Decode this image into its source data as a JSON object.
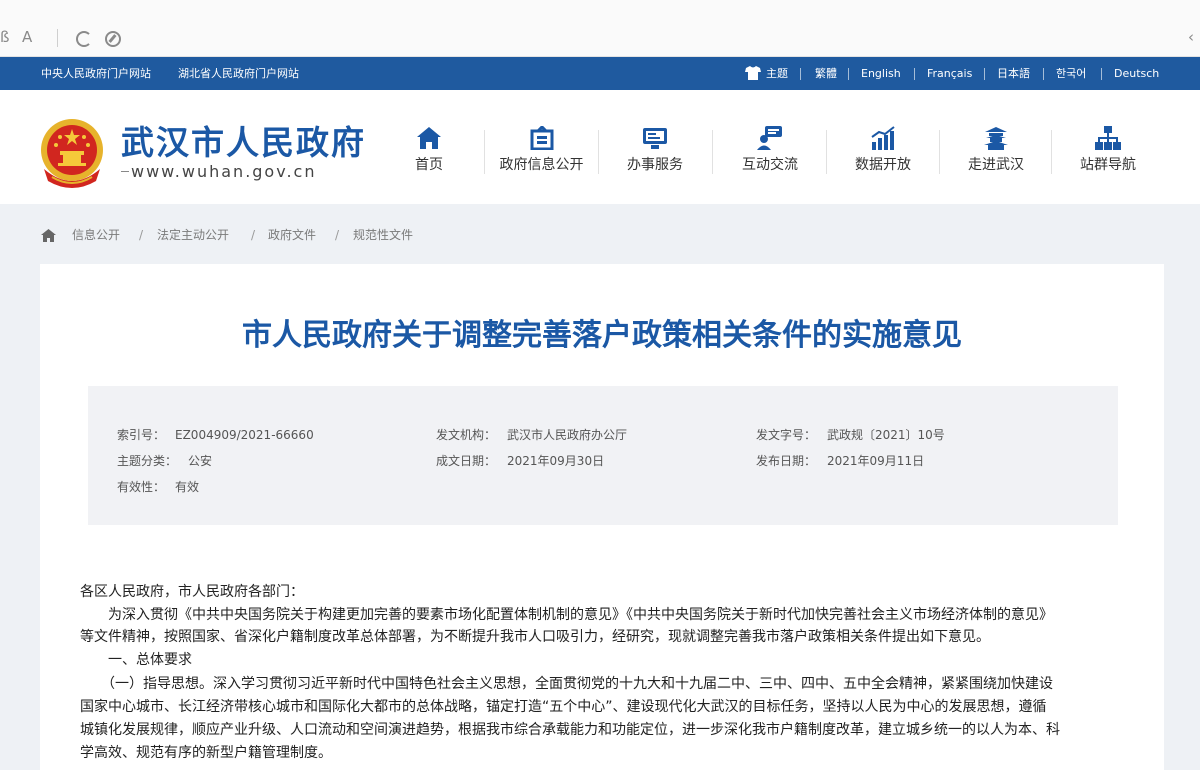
{
  "browser": {
    "glyph_left": "ß",
    "glyph_a": "A",
    "glyph_right": "‹"
  },
  "top_bar": {
    "links_left": [
      "中央人民政府门户网站",
      "湖北省人民政府门户网站"
    ],
    "links_right": [
      "主题",
      "繁體",
      "English",
      "Français",
      "日本語",
      "한국어",
      "Deutsch"
    ]
  },
  "header": {
    "site_name": "武汉市人民政府",
    "site_domain": "www.wuhan.gov.cn",
    "nav": [
      {
        "label": "首页",
        "icon": "home-icon"
      },
      {
        "label": "政府信息公开",
        "icon": "info-board-icon"
      },
      {
        "label": "办事服务",
        "icon": "service-window-icon"
      },
      {
        "label": "互动交流",
        "icon": "chat-people-icon"
      },
      {
        "label": "数据开放",
        "icon": "bar-chart-icon"
      },
      {
        "label": "走进武汉",
        "icon": "landmark-tower-icon"
      },
      {
        "label": "站群导航",
        "icon": "sitemap-icon"
      }
    ]
  },
  "breadcrumb": {
    "items": [
      "信息公开",
      "法定主动公开",
      "政府文件",
      "规范性文件"
    ],
    "separator": "/"
  },
  "document": {
    "title": "市人民政府关于调整完善落户政策相关条件的实施意见",
    "meta": {
      "index_label": "索引号：",
      "index_value": "EZ004909/2021-66660",
      "issuer_label": "发文机构：",
      "issuer_value": "武汉市人民政府办公厅",
      "doc_number_label": "发文字号：",
      "doc_number_value": "武政规〔2021〕10号",
      "category_label": "主题分类：",
      "category_value": "公安",
      "written_date_label": "成文日期：",
      "written_date_value": "2021年09月30日",
      "publish_date_label": "发布日期：",
      "publish_date_value": "2021年09月11日",
      "validity_label": "有效性：",
      "validity_value": "有效"
    },
    "body": [
      "各区人民政府，市人民政府各部门：",
      "　　为深入贯彻《中共中央国务院关于构建更加完善的要素市场化配置体制机制的意见》《中共中央国务院关于新时代加快完善社会主义市场经济体制的意见》",
      "等文件精神，按照国家、省深化户籍制度改革总体部署，为不断提升我市人口吸引力，经研究，现就调整完善我市落户政策相关条件提出如下意见。",
      "　　一、总体要求",
      "　　（一）指导思想。深入学习贯彻习近平新时代中国特色社会主义思想，全面贯彻党的十九大和十九届二中、三中、四中、五中全会精神，紧紧围绕加快建设",
      "国家中心城市、长江经济带核心城市和国际化大都市的总体战略，锚定打造“五个中心”、建设现代化大武汉的目标任务，坚持以人民为中心的发展思想，遵循",
      "城镇化发展规律，顺应产业升级、人口流动和空间演进趋势，根据我市综合承载能力和功能定位，进一步深化我市户籍制度改革，建立城乡统一的以人为本、科",
      "学高效、规范有序的新型户籍管理制度。"
    ]
  },
  "colors": {
    "top_bar": "#1f5a9f",
    "brand_blue": "#1b58a5",
    "emblem_red": "#d1261f",
    "emblem_gold": "#e7b32c"
  }
}
